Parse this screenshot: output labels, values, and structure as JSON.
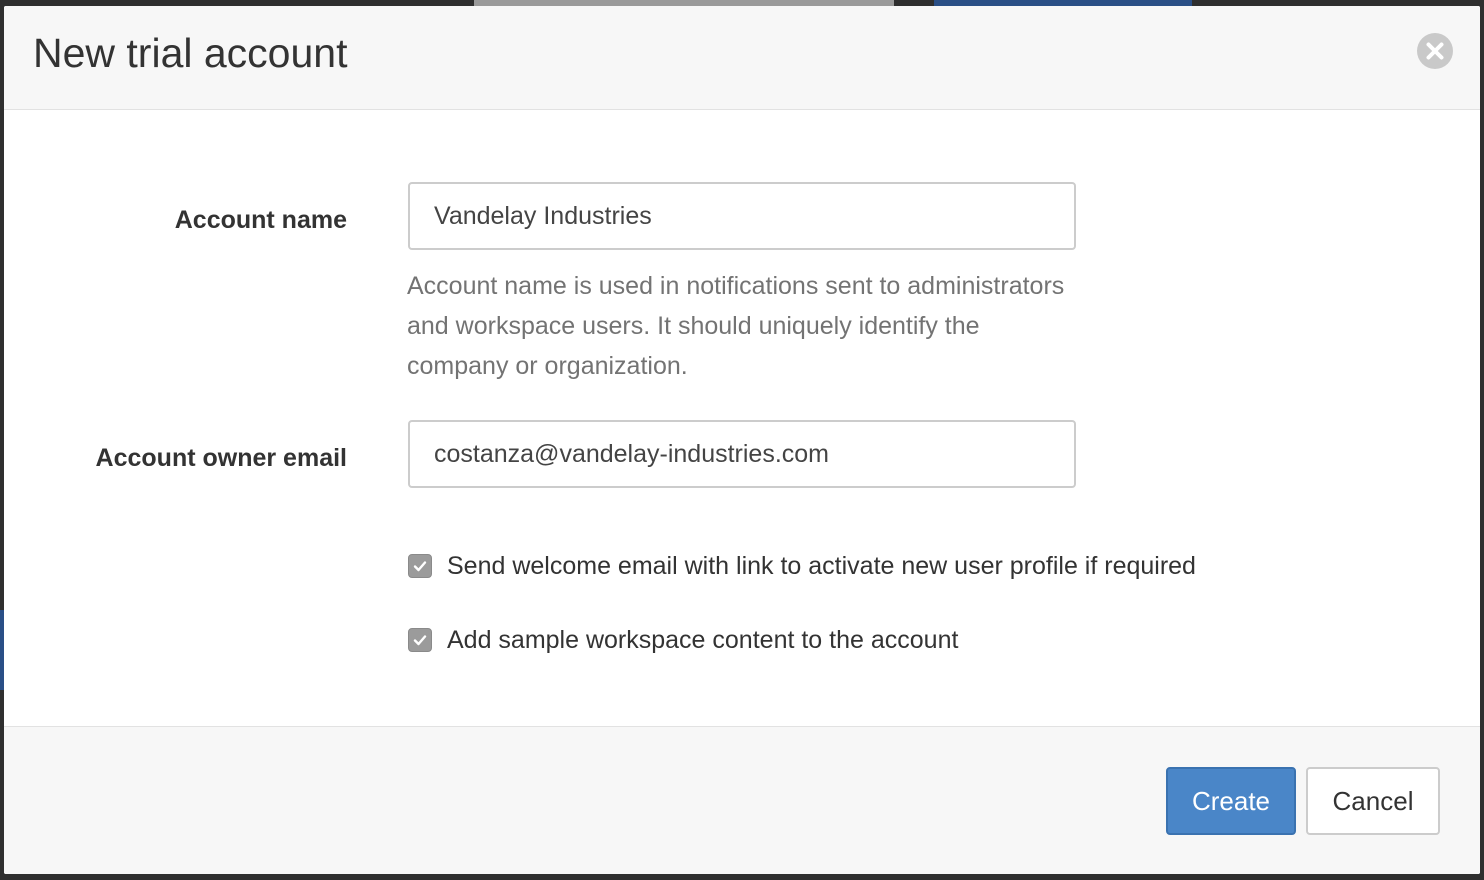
{
  "dialog": {
    "title": "New trial account",
    "close_icon": "close-circle-icon"
  },
  "form": {
    "account_name": {
      "label": "Account name",
      "value": "Vandelay Industries",
      "help": "Account name is used in notifications sent to administrators and workspace users. It should uniquely identify the company or organization."
    },
    "owner_email": {
      "label": "Account owner email",
      "value": "costanza@vandelay-industries.com"
    },
    "options": [
      {
        "label": "Send welcome email with link to activate new user profile if required",
        "checked": true
      },
      {
        "label": "Add sample workspace content to the account",
        "checked": true
      }
    ]
  },
  "footer": {
    "create_label": "Create",
    "cancel_label": "Cancel"
  },
  "colors": {
    "primary": "#4a86c8",
    "checkbox": "#9b9b9b",
    "header_bg": "#f7f7f7"
  }
}
